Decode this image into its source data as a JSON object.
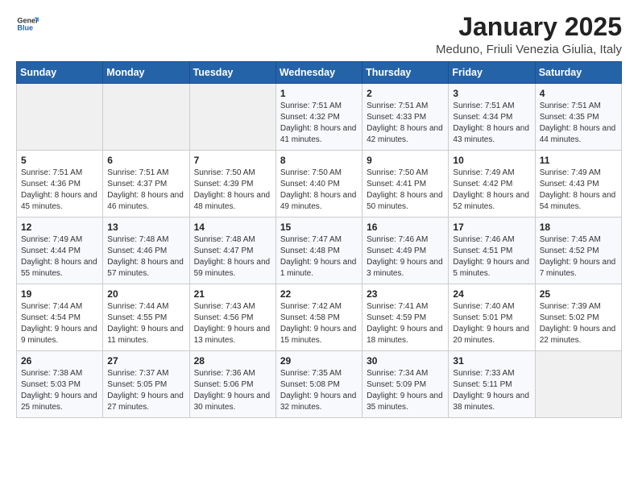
{
  "header": {
    "logo_general": "General",
    "logo_blue": "Blue",
    "title": "January 2025",
    "location": "Meduno, Friuli Venezia Giulia, Italy"
  },
  "weekdays": [
    "Sunday",
    "Monday",
    "Tuesday",
    "Wednesday",
    "Thursday",
    "Friday",
    "Saturday"
  ],
  "weeks": [
    [
      {
        "day": "",
        "info": ""
      },
      {
        "day": "",
        "info": ""
      },
      {
        "day": "",
        "info": ""
      },
      {
        "day": "1",
        "info": "Sunrise: 7:51 AM\nSunset: 4:32 PM\nDaylight: 8 hours and 41 minutes."
      },
      {
        "day": "2",
        "info": "Sunrise: 7:51 AM\nSunset: 4:33 PM\nDaylight: 8 hours and 42 minutes."
      },
      {
        "day": "3",
        "info": "Sunrise: 7:51 AM\nSunset: 4:34 PM\nDaylight: 8 hours and 43 minutes."
      },
      {
        "day": "4",
        "info": "Sunrise: 7:51 AM\nSunset: 4:35 PM\nDaylight: 8 hours and 44 minutes."
      }
    ],
    [
      {
        "day": "5",
        "info": "Sunrise: 7:51 AM\nSunset: 4:36 PM\nDaylight: 8 hours and 45 minutes."
      },
      {
        "day": "6",
        "info": "Sunrise: 7:51 AM\nSunset: 4:37 PM\nDaylight: 8 hours and 46 minutes."
      },
      {
        "day": "7",
        "info": "Sunrise: 7:50 AM\nSunset: 4:39 PM\nDaylight: 8 hours and 48 minutes."
      },
      {
        "day": "8",
        "info": "Sunrise: 7:50 AM\nSunset: 4:40 PM\nDaylight: 8 hours and 49 minutes."
      },
      {
        "day": "9",
        "info": "Sunrise: 7:50 AM\nSunset: 4:41 PM\nDaylight: 8 hours and 50 minutes."
      },
      {
        "day": "10",
        "info": "Sunrise: 7:49 AM\nSunset: 4:42 PM\nDaylight: 8 hours and 52 minutes."
      },
      {
        "day": "11",
        "info": "Sunrise: 7:49 AM\nSunset: 4:43 PM\nDaylight: 8 hours and 54 minutes."
      }
    ],
    [
      {
        "day": "12",
        "info": "Sunrise: 7:49 AM\nSunset: 4:44 PM\nDaylight: 8 hours and 55 minutes."
      },
      {
        "day": "13",
        "info": "Sunrise: 7:48 AM\nSunset: 4:46 PM\nDaylight: 8 hours and 57 minutes."
      },
      {
        "day": "14",
        "info": "Sunrise: 7:48 AM\nSunset: 4:47 PM\nDaylight: 8 hours and 59 minutes."
      },
      {
        "day": "15",
        "info": "Sunrise: 7:47 AM\nSunset: 4:48 PM\nDaylight: 9 hours and 1 minute."
      },
      {
        "day": "16",
        "info": "Sunrise: 7:46 AM\nSunset: 4:49 PM\nDaylight: 9 hours and 3 minutes."
      },
      {
        "day": "17",
        "info": "Sunrise: 7:46 AM\nSunset: 4:51 PM\nDaylight: 9 hours and 5 minutes."
      },
      {
        "day": "18",
        "info": "Sunrise: 7:45 AM\nSunset: 4:52 PM\nDaylight: 9 hours and 7 minutes."
      }
    ],
    [
      {
        "day": "19",
        "info": "Sunrise: 7:44 AM\nSunset: 4:54 PM\nDaylight: 9 hours and 9 minutes."
      },
      {
        "day": "20",
        "info": "Sunrise: 7:44 AM\nSunset: 4:55 PM\nDaylight: 9 hours and 11 minutes."
      },
      {
        "day": "21",
        "info": "Sunrise: 7:43 AM\nSunset: 4:56 PM\nDaylight: 9 hours and 13 minutes."
      },
      {
        "day": "22",
        "info": "Sunrise: 7:42 AM\nSunset: 4:58 PM\nDaylight: 9 hours and 15 minutes."
      },
      {
        "day": "23",
        "info": "Sunrise: 7:41 AM\nSunset: 4:59 PM\nDaylight: 9 hours and 18 minutes."
      },
      {
        "day": "24",
        "info": "Sunrise: 7:40 AM\nSunset: 5:01 PM\nDaylight: 9 hours and 20 minutes."
      },
      {
        "day": "25",
        "info": "Sunrise: 7:39 AM\nSunset: 5:02 PM\nDaylight: 9 hours and 22 minutes."
      }
    ],
    [
      {
        "day": "26",
        "info": "Sunrise: 7:38 AM\nSunset: 5:03 PM\nDaylight: 9 hours and 25 minutes."
      },
      {
        "day": "27",
        "info": "Sunrise: 7:37 AM\nSunset: 5:05 PM\nDaylight: 9 hours and 27 minutes."
      },
      {
        "day": "28",
        "info": "Sunrise: 7:36 AM\nSunset: 5:06 PM\nDaylight: 9 hours and 30 minutes."
      },
      {
        "day": "29",
        "info": "Sunrise: 7:35 AM\nSunset: 5:08 PM\nDaylight: 9 hours and 32 minutes."
      },
      {
        "day": "30",
        "info": "Sunrise: 7:34 AM\nSunset: 5:09 PM\nDaylight: 9 hours and 35 minutes."
      },
      {
        "day": "31",
        "info": "Sunrise: 7:33 AM\nSunset: 5:11 PM\nDaylight: 9 hours and 38 minutes."
      },
      {
        "day": "",
        "info": ""
      }
    ]
  ]
}
